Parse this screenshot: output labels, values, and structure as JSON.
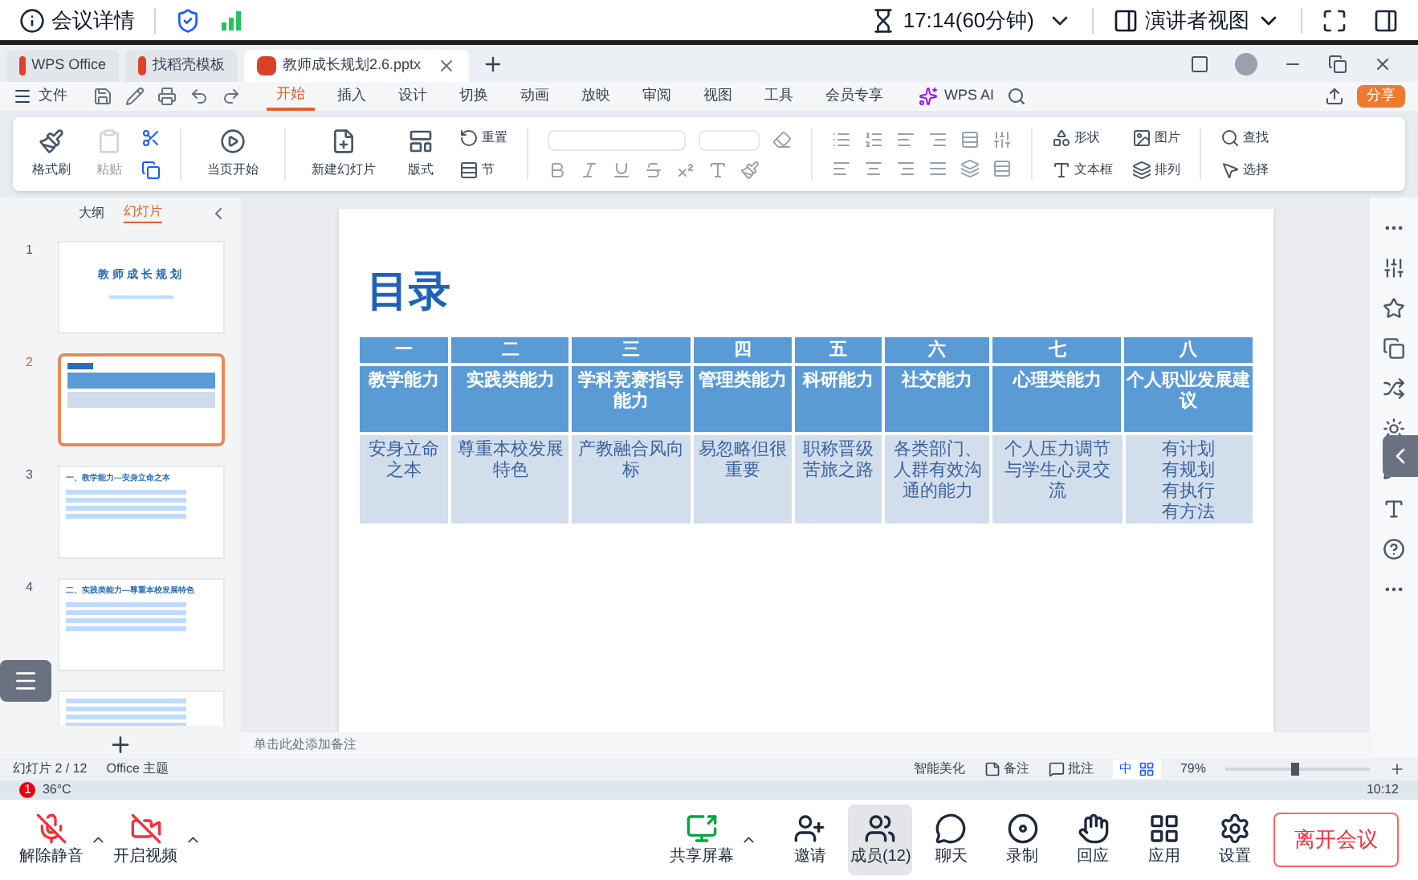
{
  "meeting_bar": {
    "title": "会议详情",
    "time": "17:14(60分钟)",
    "view": "演讲者视图"
  },
  "wps_tabs": [
    {
      "label": "WPS Office",
      "selected": false
    },
    {
      "label": "找稻壳模板",
      "selected": false
    },
    {
      "label": "教师成长规划2.6.pptx",
      "selected": true
    }
  ],
  "menu": {
    "file": "文件",
    "tabs": [
      {
        "label": "开始",
        "selected": true
      },
      {
        "label": "插入",
        "selected": false
      },
      {
        "label": "设计",
        "selected": false
      },
      {
        "label": "切换",
        "selected": false
      },
      {
        "label": "动画",
        "selected": false
      },
      {
        "label": "放映",
        "selected": false
      },
      {
        "label": "审阅",
        "selected": false
      },
      {
        "label": "视图",
        "selected": false
      },
      {
        "label": "工具",
        "selected": false
      },
      {
        "label": "会员专享",
        "selected": false
      }
    ],
    "ai": "WPS AI",
    "share": "分享"
  },
  "ribbon": {
    "format_painter": "格式刷",
    "paste": {
      "label": "粘贴",
      "disabled": true
    },
    "start": "当页开始",
    "new_slide": "新建幻灯片",
    "layout": "版式",
    "reset": "重置",
    "section": "节",
    "shape": "形状",
    "picture": "图片",
    "textbox": "文本框",
    "arrange": "排列",
    "find": "查找",
    "select": "选择"
  },
  "slide_panel": {
    "tabs": [
      {
        "label": "大纲",
        "selected": false
      },
      {
        "label": "幻灯片",
        "selected": true
      }
    ],
    "slides": [
      {
        "number": "1",
        "kind": "title",
        "title": "教师成长规划",
        "selected": false
      },
      {
        "number": "2",
        "kind": "table",
        "selected": true
      },
      {
        "number": "3",
        "kind": "list",
        "title": "一、教学能力—安身立命之本",
        "selected": false
      },
      {
        "number": "4",
        "kind": "list",
        "title": "二、实践类能力—尊重本校发展特色",
        "selected": false
      }
    ]
  },
  "slide": {
    "title": "目录",
    "numbers": [
      "一",
      "二",
      "三",
      "四",
      "五",
      "六",
      "七",
      "八"
    ],
    "headings": [
      "教学能力",
      "实践类能力",
      "学科竞赛指导能力",
      "管理类能力",
      "科研能力",
      "社交能力",
      "心理类能力",
      "个人职业发展建议"
    ],
    "descriptions": [
      "安身立命之本",
      "尊重本校发展特色",
      "产教融合风向标",
      "易忽略但很重要",
      "职称晋级苦旅之路",
      "各类部门、人群有效沟通的能力",
      "个人压力调节与学生心灵交流",
      [
        "有计划",
        "有规划",
        "有执行",
        "有方法"
      ]
    ]
  },
  "notes": {
    "placeholder": "单击此处添加备注"
  },
  "status_bar": {
    "slide_count": "幻灯片 2 / 12",
    "theme": "Office 主题",
    "beautify": "智能美化",
    "notes": "备注",
    "comments": "批注",
    "ime": "中",
    "zoom": "79%",
    "zoom_level": {
      "level": 0.45
    }
  },
  "taskbar": {
    "badge": "1",
    "weather": "36°C",
    "time": "10:12"
  },
  "meeting_toolbar": {
    "items": [
      {
        "label": "解除静音",
        "selected": false
      },
      {
        "label": "开启视频",
        "selected": false
      },
      {
        "label": "共享屏幕",
        "selected": false
      },
      {
        "label": "邀请",
        "selected": false
      },
      {
        "label": "成员(12)",
        "selected": true
      },
      {
        "label": "聊天",
        "selected": false
      },
      {
        "label": "录制",
        "selected": false
      },
      {
        "label": "回应",
        "selected": false
      },
      {
        "label": "应用",
        "selected": false
      },
      {
        "label": "设置",
        "selected": false
      }
    ],
    "leave": "离开会议"
  }
}
